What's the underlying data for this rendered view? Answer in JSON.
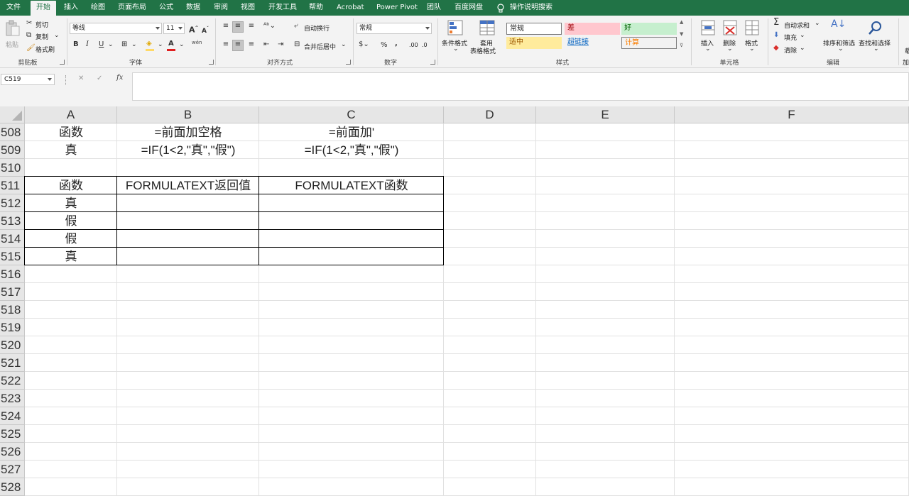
{
  "menu": {
    "tabs": [
      "文件",
      "开始",
      "插入",
      "绘图",
      "页面布局",
      "公式",
      "数据",
      "审阅",
      "视图",
      "开发工具",
      "帮助",
      "Acrobat",
      "Power Pivot",
      "团队",
      "百度网盘"
    ],
    "active_tab": "开始",
    "tell_me": "操作说明搜索",
    "accent_color": "#217346"
  },
  "ribbon": {
    "clipboard": {
      "paste": "粘贴",
      "cut": "剪切",
      "copy": "复制",
      "format_painter": "格式刷",
      "label": "剪贴板"
    },
    "font": {
      "font_name": "等线",
      "font_size": "11",
      "bold": "B",
      "italic": "I",
      "underline": "U",
      "grow": "A",
      "shrink": "A",
      "font_color_glyph": "A",
      "phonetic": "wén",
      "label": "字体"
    },
    "alignment": {
      "wrap_text": "自动换行",
      "merge_center": "合并后居中",
      "label": "对齐方式"
    },
    "number": {
      "format": "常规",
      "percent": "%",
      "comma": ",",
      "inc_decimal": ".00",
      "dec_decimal": ".0",
      "label": "数字"
    },
    "styles": {
      "conditional": "条件格式",
      "table_format": [
        "套用",
        "表格格式"
      ],
      "boxes": [
        {
          "text": "常规",
          "bg": "#ffffff",
          "fg": "#222222"
        },
        {
          "text": "差",
          "bg": "#ffc7ce",
          "fg": "#9c0006"
        },
        {
          "text": "好",
          "bg": "#c6efce",
          "fg": "#006100"
        },
        {
          "text": "适中",
          "bg": "#ffeb9c",
          "fg": "#9c5700"
        },
        {
          "text": "超链接",
          "bg": "#f3f3f3",
          "fg": "#0563c1"
        },
        {
          "text": "计算",
          "bg": "#f2f2f2",
          "fg": "#fa7d00"
        }
      ],
      "label": "样式"
    },
    "cells": {
      "insert": "插入",
      "delete": "删除",
      "format": "格式",
      "label": "单元格"
    },
    "editing": {
      "autosum": "自动求和",
      "fill": "填充",
      "clear": "清除",
      "sort_filter": "排序和筛选",
      "find_select": "查找和选择",
      "label": "编辑"
    },
    "extra": {
      "cut_off_1": "加",
      "cut_off_2": "载"
    }
  },
  "formula_bar": {
    "name_box": "C519",
    "cancel": "✕",
    "enter": "✓",
    "fx": "fx",
    "value": ""
  },
  "columns": [
    {
      "label": "A",
      "id": "A"
    },
    {
      "label": "B",
      "id": "B"
    },
    {
      "label": "C",
      "id": "C"
    },
    {
      "label": "D",
      "id": "D"
    },
    {
      "label": "E",
      "id": "E"
    },
    {
      "label": "F",
      "id": "F"
    }
  ],
  "rows": [
    "508",
    "509",
    "510",
    "511",
    "512",
    "513",
    "514",
    "515",
    "516",
    "517",
    "518",
    "519",
    "520",
    "521",
    "522",
    "523",
    "524",
    "525",
    "526",
    "527",
    "528"
  ],
  "cells": [
    {
      "row": "508",
      "col": "A",
      "value": "函数"
    },
    {
      "row": "508",
      "col": "B",
      "value": "=前面加空格"
    },
    {
      "row": "508",
      "col": "C",
      "value": "=前面加'"
    },
    {
      "row": "509",
      "col": "A",
      "value": "真"
    },
    {
      "row": "509",
      "col": "B",
      "value": "=IF(1<2,\"真\",\"假\")"
    },
    {
      "row": "509",
      "col": "C",
      "value": "=IF(1<2,\"真\",\"假\")"
    },
    {
      "row": "511",
      "col": "A",
      "value": "函数"
    },
    {
      "row": "511",
      "col": "B",
      "value": "FORMULATEXT返回值"
    },
    {
      "row": "511",
      "col": "C",
      "value": "FORMULATEXT函数"
    },
    {
      "row": "512",
      "col": "A",
      "value": "真"
    },
    {
      "row": "513",
      "col": "A",
      "value": "假"
    },
    {
      "row": "514",
      "col": "A",
      "value": "假"
    },
    {
      "row": "515",
      "col": "A",
      "value": "真"
    }
  ]
}
